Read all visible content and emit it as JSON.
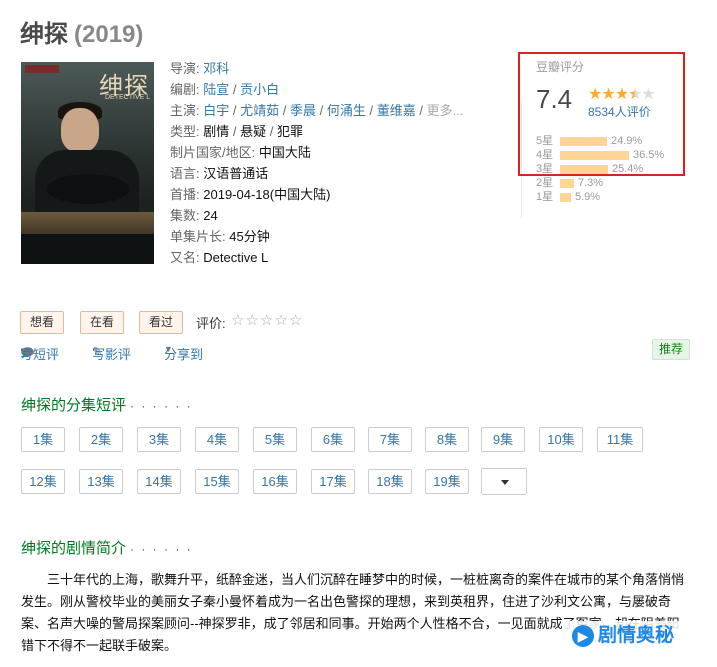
{
  "movie": {
    "title": "绅探",
    "year": "(2019)"
  },
  "poster": {
    "title": "绅探",
    "subtitle": "DETECTIVE L"
  },
  "info": {
    "director": {
      "label": "导演:",
      "value": "邓科"
    },
    "writer": {
      "label": "编剧:",
      "values": [
        "陆宣",
        "贡小白"
      ]
    },
    "cast": {
      "label": "主演:",
      "values": [
        "白宇",
        "尤靖茹",
        "季晨",
        "何涌生",
        "董维嘉"
      ],
      "more": "更多..."
    },
    "genre": {
      "label": "类型:",
      "values": [
        "剧情",
        "悬疑",
        "犯罪"
      ]
    },
    "country": {
      "label": "制片国家/地区:",
      "value": "中国大陆"
    },
    "language": {
      "label": "语言:",
      "value": "汉语普通话"
    },
    "premiere": {
      "label": "首播:",
      "value": "2019-04-18(中国大陆)"
    },
    "episodes": {
      "label": "集数:",
      "value": "24"
    },
    "runtime": {
      "label": "单集片长:",
      "value": "45分钟"
    },
    "aka": {
      "label": "又名:",
      "value": "Detective L"
    }
  },
  "rating": {
    "label": "豆瓣评分",
    "score": "7.4",
    "stars": 3.5,
    "count": "8534人评价",
    "breakdown": [
      {
        "label": "5星",
        "pct": "24.9%",
        "value": 24.9
      },
      {
        "label": "4星",
        "pct": "36.5%",
        "value": 36.5
      },
      {
        "label": "3星",
        "pct": "25.4%",
        "value": 25.4
      },
      {
        "label": "2星",
        "pct": "7.3%",
        "value": 7.3
      },
      {
        "label": "1星",
        "pct": "5.9%",
        "value": 5.9
      }
    ]
  },
  "actions": {
    "want": "想看",
    "watching": "在看",
    "watched": "看过",
    "rate_label": "评价:"
  },
  "tools": {
    "write_short": "写短评",
    "write_review": "写影评",
    "share": "分享到",
    "recommend": "推荐"
  },
  "episodes_section": {
    "title": "绅探的分集短评",
    "dots": "· · · · · ·",
    "items": [
      "1集",
      "2集",
      "3集",
      "4集",
      "5集",
      "6集",
      "7集",
      "8集",
      "9集",
      "10集",
      "11集",
      "12集",
      "13集",
      "14集",
      "15集",
      "16集",
      "17集",
      "18集",
      "19集"
    ]
  },
  "synopsis": {
    "title": "绅探的剧情简介",
    "dots": "· · · · · ·",
    "text": "三十年代的上海，歌舞升平，纸醉金迷，当人们沉醉在睡梦中的时候，一桩桩离奇的案件在城市的某个角落悄悄发生。刚从警校毕业的美丽女子秦小曼怀着成为一名出色警探的理想，来到英租界，住进了沙利文公寓，与屡破奇案、名声大噪的警局探案顾问--神探罗非，成了邻居和同事。开始两个人性格不合，一见面就成了冤家，却在阴差阳错下不得不一起联手破案。"
  },
  "watermark": {
    "text": "剧情奥秘"
  }
}
